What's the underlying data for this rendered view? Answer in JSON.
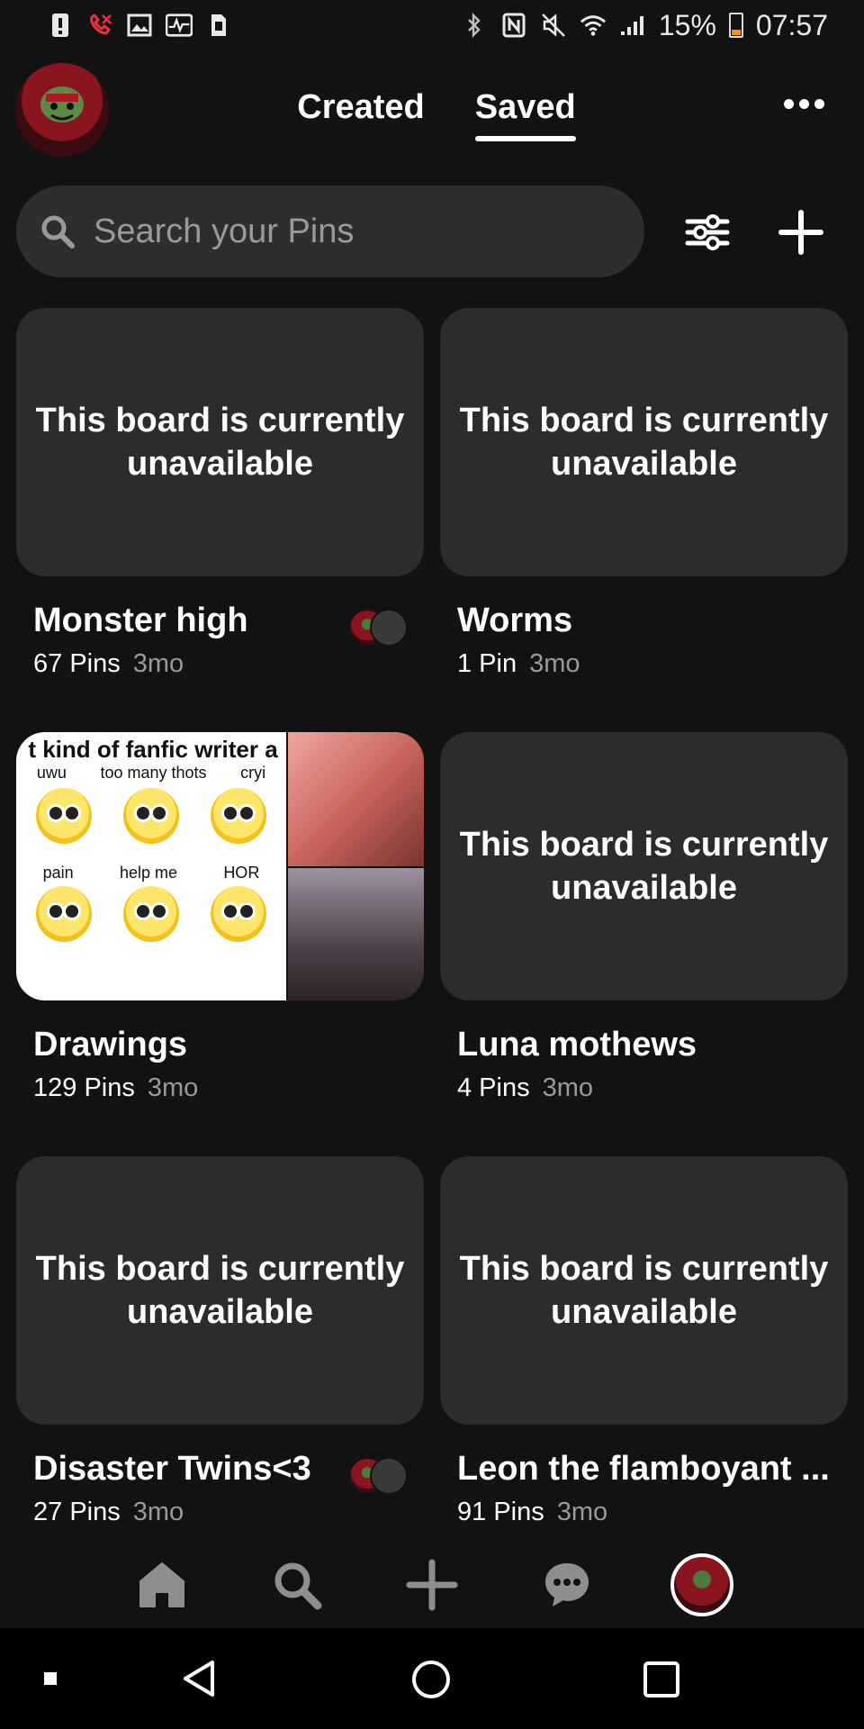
{
  "status_bar": {
    "battery_percent": "15%",
    "time": "07:57",
    "left_icons": [
      "alert-icon",
      "missed-call-icon",
      "gallery-icon",
      "activity-icon",
      "sim-icon"
    ],
    "right_icons": [
      "bluetooth-icon",
      "nfc-icon",
      "mute-icon",
      "wifi-icon",
      "signal-icon"
    ]
  },
  "header": {
    "tabs": [
      {
        "label": "Created",
        "active": false
      },
      {
        "label": "Saved",
        "active": true
      }
    ]
  },
  "search": {
    "placeholder": "Search your Pins",
    "value": ""
  },
  "boards": [
    {
      "title": "Monster high",
      "pins": "67 Pins",
      "age": "3mo",
      "cover_text": "This board is currently unavailable",
      "collaborators": true
    },
    {
      "title": "Worms",
      "pins": "1 Pin",
      "age": "3mo",
      "cover_text": "This board is currently unavailable",
      "collaborators": false
    },
    {
      "title": "Drawings",
      "pins": "129 Pins",
      "age": "3mo",
      "cover_text": "",
      "collaborators": false,
      "collage_text": {
        "heading": "t kind of fanfic writer a",
        "row1": [
          "uwu",
          "too many thots",
          "cryi"
        ],
        "row2": [
          "pain",
          "help me",
          "HOR"
        ]
      }
    },
    {
      "title": "Luna mothews",
      "pins": "4 Pins",
      "age": "3mo",
      "cover_text": "This board is currently unavailable",
      "collaborators": false
    },
    {
      "title": "Disaster Twins<3",
      "pins": "27 Pins",
      "age": "3mo",
      "cover_text": "This board is currently unavailable",
      "collaborators": true
    },
    {
      "title": "Leon the flamboyant ...",
      "pins": "91 Pins",
      "age": "3mo",
      "cover_text": "This board is currently unavailable",
      "collaborators": false
    }
  ],
  "bottom_nav": [
    "home-icon",
    "search-icon",
    "plus-icon",
    "chat-icon",
    "profile-avatar"
  ],
  "system_nav": [
    "square-small-icon",
    "back-icon",
    "home-circle-icon",
    "recents-icon"
  ]
}
